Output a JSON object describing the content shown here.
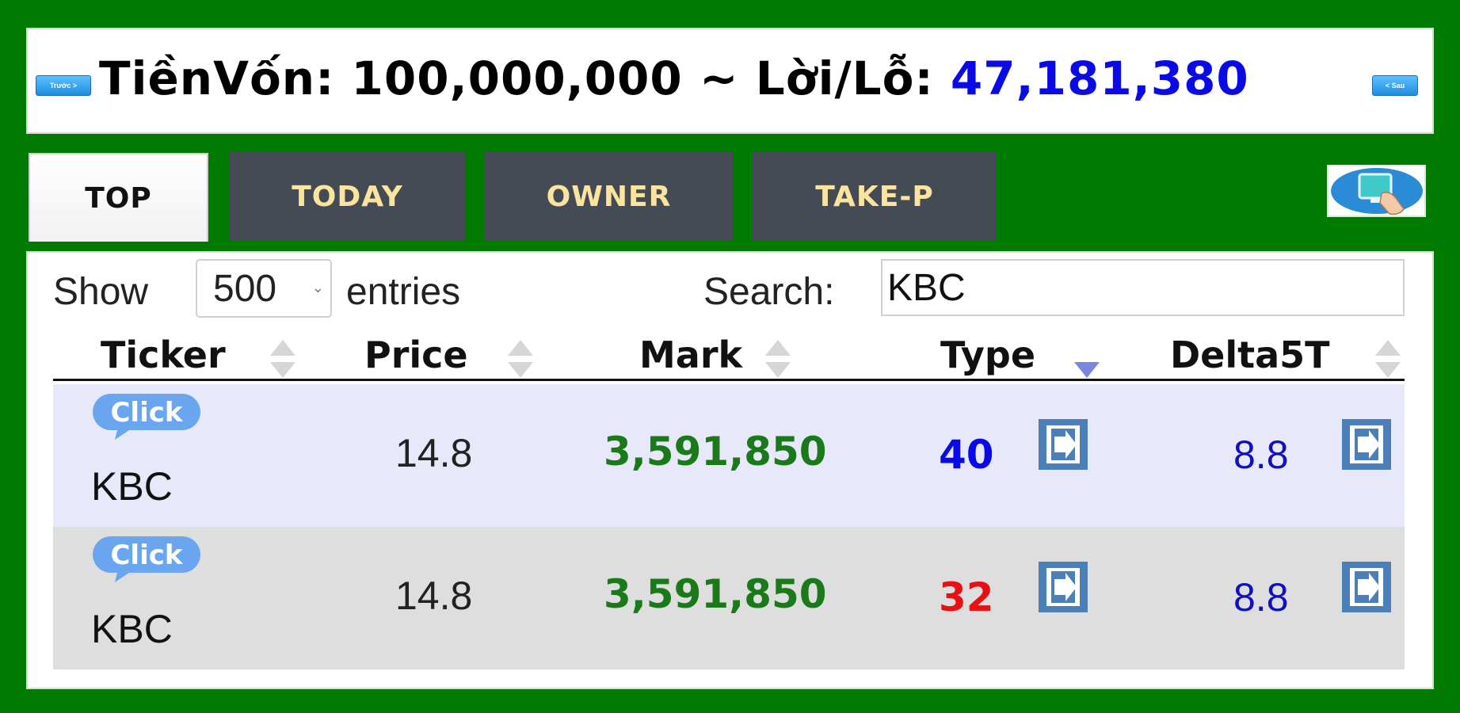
{
  "header": {
    "prev_label": "Trước >",
    "next_label": "< Sau",
    "capital_label": "TiềnVốn:",
    "capital_value": "100,000,000",
    "separator": "~",
    "pl_label": "Lời/Lỗ:",
    "pl_value": "47,181,380"
  },
  "tabs": [
    {
      "label": "TOP",
      "active": true
    },
    {
      "label": "TODAY",
      "active": false
    },
    {
      "label": "OWNER",
      "active": false
    },
    {
      "label": "TAKE-P",
      "active": false
    }
  ],
  "controls": {
    "show_label": "Show",
    "entries_value": "500",
    "entries_label": "entries",
    "search_label": "Search:",
    "search_value": "KBC"
  },
  "table": {
    "columns": [
      "Ticker",
      "Price",
      "Mark",
      "Type",
      "Delta5T"
    ],
    "sorted_column": "Type",
    "sort_direction": "desc",
    "rows": [
      {
        "badge": "Click",
        "ticker": "KBC",
        "price": "14.8",
        "mark": "3,591,850",
        "type": "40",
        "type_color": "#0a0ae8",
        "delta": "8.8"
      },
      {
        "badge": "Click",
        "ticker": "KBC",
        "price": "14.8",
        "mark": "3,591,850",
        "type": "32",
        "type_color": "#e81010",
        "delta": "8.8"
      }
    ]
  },
  "colors": {
    "background": "#007a00",
    "profit": "#0a0ae8",
    "mark": "#1a7a1a",
    "tab_dark": "#454b55",
    "tab_text": "#fbe3a0",
    "row_odd": "#e8e8fb",
    "row_even": "#dedede"
  },
  "icons": {
    "share": "monitor-hand-icon",
    "row_action": "enter-icon",
    "sort": "sort-arrows-icon"
  }
}
